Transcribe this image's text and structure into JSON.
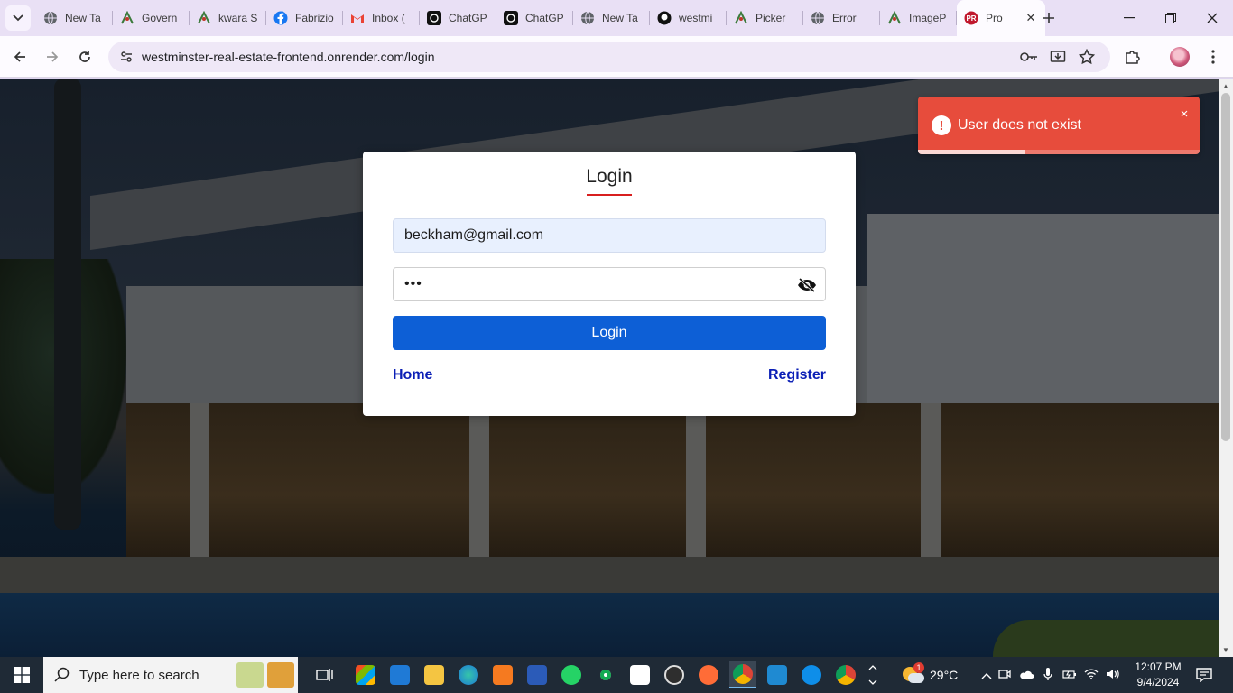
{
  "browser": {
    "tabs": [
      {
        "label": "New Ta",
        "icon": "globe-icon"
      },
      {
        "label": "Govern",
        "icon": "site-icon"
      },
      {
        "label": "kwara S",
        "icon": "site-icon"
      },
      {
        "label": "Fabrizio",
        "icon": "facebook-icon"
      },
      {
        "label": "Inbox (",
        "icon": "gmail-icon"
      },
      {
        "label": "ChatGP",
        "icon": "chatgpt-icon"
      },
      {
        "label": "ChatGP",
        "icon": "chatgpt-icon"
      },
      {
        "label": "New Ta",
        "icon": "globe-icon"
      },
      {
        "label": "westmi",
        "icon": "github-icon"
      },
      {
        "label": "Picker",
        "icon": "site-icon"
      },
      {
        "label": "Error",
        "icon": "globe-icon"
      },
      {
        "label": "ImageP",
        "icon": "site-icon"
      }
    ],
    "active_tab": {
      "label": "Pro",
      "icon": "pr-icon"
    },
    "url": "westminster-real-estate-frontend.onrender.com/login"
  },
  "login": {
    "title": "Login",
    "email_value": "beckham@gmail.com",
    "password_value": "•••",
    "button_label": "Login",
    "home_link": "Home",
    "register_link": "Register"
  },
  "toast": {
    "message": "User does not exist",
    "close": "×",
    "progress": 0.38,
    "color": "#e74c3c"
  },
  "taskbar": {
    "search_placeholder": "Type here to search",
    "weather_badge": "1",
    "temperature": "29°C",
    "time": "12:07 PM",
    "date": "9/4/2024"
  },
  "colors": {
    "accent": "#0d5fd6",
    "title_underline": "#d81f1f",
    "link": "#0b1fb6"
  }
}
